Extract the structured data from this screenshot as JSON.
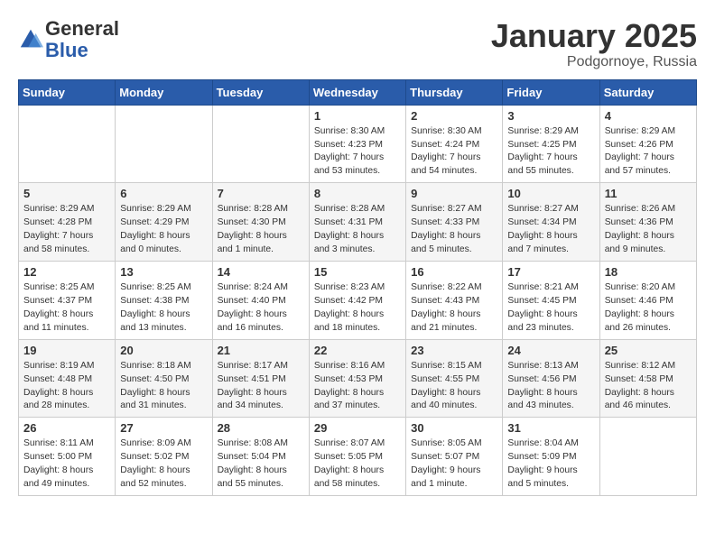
{
  "logo": {
    "general": "General",
    "blue": "Blue"
  },
  "header": {
    "month": "January 2025",
    "location": "Podgornoye, Russia"
  },
  "weekdays": [
    "Sunday",
    "Monday",
    "Tuesday",
    "Wednesday",
    "Thursday",
    "Friday",
    "Saturday"
  ],
  "weeks": [
    [
      {
        "day": "",
        "info": ""
      },
      {
        "day": "",
        "info": ""
      },
      {
        "day": "",
        "info": ""
      },
      {
        "day": "1",
        "info": "Sunrise: 8:30 AM\nSunset: 4:23 PM\nDaylight: 7 hours and 53 minutes."
      },
      {
        "day": "2",
        "info": "Sunrise: 8:30 AM\nSunset: 4:24 PM\nDaylight: 7 hours and 54 minutes."
      },
      {
        "day": "3",
        "info": "Sunrise: 8:29 AM\nSunset: 4:25 PM\nDaylight: 7 hours and 55 minutes."
      },
      {
        "day": "4",
        "info": "Sunrise: 8:29 AM\nSunset: 4:26 PM\nDaylight: 7 hours and 57 minutes."
      }
    ],
    [
      {
        "day": "5",
        "info": "Sunrise: 8:29 AM\nSunset: 4:28 PM\nDaylight: 7 hours and 58 minutes."
      },
      {
        "day": "6",
        "info": "Sunrise: 8:29 AM\nSunset: 4:29 PM\nDaylight: 8 hours and 0 minutes."
      },
      {
        "day": "7",
        "info": "Sunrise: 8:28 AM\nSunset: 4:30 PM\nDaylight: 8 hours and 1 minute."
      },
      {
        "day": "8",
        "info": "Sunrise: 8:28 AM\nSunset: 4:31 PM\nDaylight: 8 hours and 3 minutes."
      },
      {
        "day": "9",
        "info": "Sunrise: 8:27 AM\nSunset: 4:33 PM\nDaylight: 8 hours and 5 minutes."
      },
      {
        "day": "10",
        "info": "Sunrise: 8:27 AM\nSunset: 4:34 PM\nDaylight: 8 hours and 7 minutes."
      },
      {
        "day": "11",
        "info": "Sunrise: 8:26 AM\nSunset: 4:36 PM\nDaylight: 8 hours and 9 minutes."
      }
    ],
    [
      {
        "day": "12",
        "info": "Sunrise: 8:25 AM\nSunset: 4:37 PM\nDaylight: 8 hours and 11 minutes."
      },
      {
        "day": "13",
        "info": "Sunrise: 8:25 AM\nSunset: 4:38 PM\nDaylight: 8 hours and 13 minutes."
      },
      {
        "day": "14",
        "info": "Sunrise: 8:24 AM\nSunset: 4:40 PM\nDaylight: 8 hours and 16 minutes."
      },
      {
        "day": "15",
        "info": "Sunrise: 8:23 AM\nSunset: 4:42 PM\nDaylight: 8 hours and 18 minutes."
      },
      {
        "day": "16",
        "info": "Sunrise: 8:22 AM\nSunset: 4:43 PM\nDaylight: 8 hours and 21 minutes."
      },
      {
        "day": "17",
        "info": "Sunrise: 8:21 AM\nSunset: 4:45 PM\nDaylight: 8 hours and 23 minutes."
      },
      {
        "day": "18",
        "info": "Sunrise: 8:20 AM\nSunset: 4:46 PM\nDaylight: 8 hours and 26 minutes."
      }
    ],
    [
      {
        "day": "19",
        "info": "Sunrise: 8:19 AM\nSunset: 4:48 PM\nDaylight: 8 hours and 28 minutes."
      },
      {
        "day": "20",
        "info": "Sunrise: 8:18 AM\nSunset: 4:50 PM\nDaylight: 8 hours and 31 minutes."
      },
      {
        "day": "21",
        "info": "Sunrise: 8:17 AM\nSunset: 4:51 PM\nDaylight: 8 hours and 34 minutes."
      },
      {
        "day": "22",
        "info": "Sunrise: 8:16 AM\nSunset: 4:53 PM\nDaylight: 8 hours and 37 minutes."
      },
      {
        "day": "23",
        "info": "Sunrise: 8:15 AM\nSunset: 4:55 PM\nDaylight: 8 hours and 40 minutes."
      },
      {
        "day": "24",
        "info": "Sunrise: 8:13 AM\nSunset: 4:56 PM\nDaylight: 8 hours and 43 minutes."
      },
      {
        "day": "25",
        "info": "Sunrise: 8:12 AM\nSunset: 4:58 PM\nDaylight: 8 hours and 46 minutes."
      }
    ],
    [
      {
        "day": "26",
        "info": "Sunrise: 8:11 AM\nSunset: 5:00 PM\nDaylight: 8 hours and 49 minutes."
      },
      {
        "day": "27",
        "info": "Sunrise: 8:09 AM\nSunset: 5:02 PM\nDaylight: 8 hours and 52 minutes."
      },
      {
        "day": "28",
        "info": "Sunrise: 8:08 AM\nSunset: 5:04 PM\nDaylight: 8 hours and 55 minutes."
      },
      {
        "day": "29",
        "info": "Sunrise: 8:07 AM\nSunset: 5:05 PM\nDaylight: 8 hours and 58 minutes."
      },
      {
        "day": "30",
        "info": "Sunrise: 8:05 AM\nSunset: 5:07 PM\nDaylight: 9 hours and 1 minute."
      },
      {
        "day": "31",
        "info": "Sunrise: 8:04 AM\nSunset: 5:09 PM\nDaylight: 9 hours and 5 minutes."
      },
      {
        "day": "",
        "info": ""
      }
    ]
  ]
}
